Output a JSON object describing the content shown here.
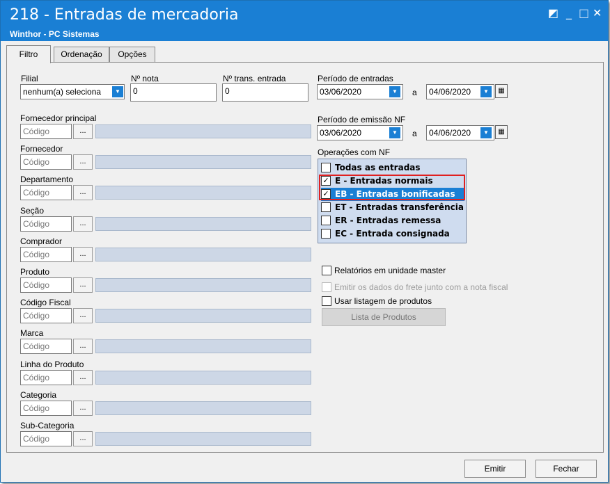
{
  "window": {
    "title": "218 - Entradas de mercadoria",
    "subtitle": "Winthor - PC Sistemas"
  },
  "tabs": [
    {
      "label": "Filtro"
    },
    {
      "label": "Ordenação"
    },
    {
      "label": "Opções"
    }
  ],
  "filial": {
    "label": "Filial",
    "value": "nenhum(a) seleciona"
  },
  "nota": {
    "label": "Nº nota",
    "value": "0"
  },
  "trans": {
    "label": "Nº trans. entrada",
    "value": "0"
  },
  "periodo_entradas": {
    "label": "Período de entradas",
    "start": "03/06/2020",
    "sep": "a",
    "end": "04/06/2020"
  },
  "periodo_emissao": {
    "label": "Período de emissão NF",
    "start": "03/06/2020",
    "sep": "a",
    "end": "04/06/2020"
  },
  "operacoes": {
    "label": "Operações com NF",
    "items": [
      {
        "text": "Todas as entradas",
        "checked": false
      },
      {
        "text": "E   - Entradas normais",
        "checked": true
      },
      {
        "text": "EB - Entradas bonificadas",
        "checked": true
      },
      {
        "text": "ET - Entradas transferência",
        "checked": false
      },
      {
        "text": "ER - Entradas remessa",
        "checked": false
      },
      {
        "text": "EC - Entrada consignada",
        "checked": false
      }
    ]
  },
  "lookups": [
    {
      "label": "Fornecedor principal",
      "placeholder": "Código"
    },
    {
      "label": "Fornecedor",
      "placeholder": "Código"
    },
    {
      "label": "Departamento",
      "placeholder": "Código"
    },
    {
      "label": "Seção",
      "placeholder": "Código"
    },
    {
      "label": "Comprador",
      "placeholder": "Código"
    },
    {
      "label": "Produto",
      "placeholder": "Código"
    },
    {
      "label": "Código Fiscal",
      "placeholder": "Código"
    },
    {
      "label": "Marca",
      "placeholder": "Código"
    },
    {
      "label": "Linha do Produto",
      "placeholder": "Código"
    },
    {
      "label": "Categoria",
      "placeholder": "Código"
    },
    {
      "label": "Sub-Categoria",
      "placeholder": "Código"
    }
  ],
  "ellipsis": "...",
  "options": {
    "master": {
      "label": "Relatórios em unidade master",
      "checked": false,
      "enabled": true
    },
    "frete": {
      "label": "Emitir os dados do frete junto com a nota fiscal",
      "checked": false,
      "enabled": false
    },
    "listagem": {
      "label": "Usar listagem de produtos",
      "checked": false,
      "enabled": true
    }
  },
  "lista_button": {
    "label": "Lista de Produtos"
  },
  "buttons": {
    "emitir": "Emitir",
    "fechar": "Fechar"
  },
  "colors": {
    "titlebar": "#1a7fd4",
    "selection": "#1a7fd4",
    "highlight": "#e02020",
    "disabled_field": "#cdd7e6"
  }
}
